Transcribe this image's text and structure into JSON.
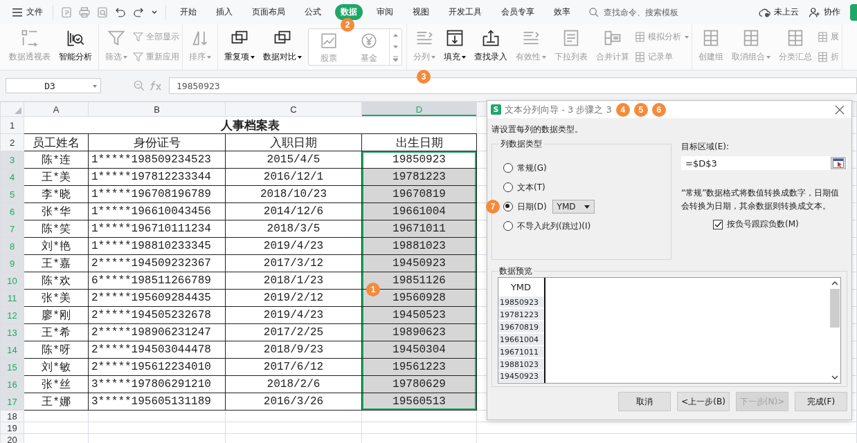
{
  "menu_bar": {
    "file": "文件",
    "tabs": [
      {
        "label": "开始",
        "selected": false
      },
      {
        "label": "插入",
        "selected": false
      },
      {
        "label": "页面布局",
        "selected": false
      },
      {
        "label": "公式",
        "selected": false
      },
      {
        "label": "数据",
        "selected": true,
        "marker": "2"
      },
      {
        "label": "审阅",
        "selected": false
      },
      {
        "label": "视图",
        "selected": false
      },
      {
        "label": "开发工具",
        "selected": false
      },
      {
        "label": "会员专享",
        "selected": false
      },
      {
        "label": "效率",
        "selected": false
      }
    ],
    "search": {
      "placeholder": "查找命令、搜索模板"
    },
    "cloud_status": "未上云",
    "collaborate": "协作"
  },
  "ribbon": {
    "groups": [
      {
        "items": [
          {
            "kind": "large",
            "label": "数据透视表",
            "disabled": true,
            "dropdown": false
          },
          {
            "kind": "large",
            "label": "智能分析",
            "disabled": false,
            "dropdown": false
          }
        ]
      },
      {
        "items": [
          {
            "kind": "large",
            "label": "筛选",
            "disabled": true,
            "dropdown": true
          },
          {
            "kind": "stack",
            "items": [
              {
                "label": "全部显示",
                "disabled": true,
                "dropdown": false
              },
              {
                "label": "重新应用",
                "disabled": true,
                "dropdown": false
              }
            ]
          }
        ]
      },
      {
        "items": [
          {
            "kind": "large",
            "label": "排序",
            "disabled": true,
            "dropdown": true
          }
        ]
      },
      {
        "items": [
          {
            "kind": "large",
            "label": "重复项",
            "disabled": false,
            "dropdown": true
          },
          {
            "kind": "large",
            "label": "数据对比",
            "disabled": false,
            "dropdown": true
          },
          {
            "kind": "gallery",
            "items": [
              {
                "label": "股票",
                "disabled": true
              },
              {
                "label": "基金",
                "disabled": true
              }
            ]
          }
        ]
      },
      {
        "items": [
          {
            "kind": "large",
            "label": "分列",
            "disabled": true,
            "dropdown": true,
            "marker": "3"
          },
          {
            "kind": "large",
            "label": "填充",
            "disabled": false,
            "dropdown": true
          },
          {
            "kind": "large",
            "label": "查找录入",
            "disabled": false,
            "dropdown": false
          },
          {
            "kind": "large",
            "label": "有效性",
            "disabled": true,
            "dropdown": true
          },
          {
            "kind": "large",
            "label": "下拉列表",
            "disabled": true,
            "dropdown": false
          },
          {
            "kind": "large",
            "label": "合并计算",
            "disabled": true,
            "dropdown": false
          },
          {
            "kind": "stack",
            "items": [
              {
                "label": "模拟分析",
                "disabled": true,
                "dropdown": true
              },
              {
                "label": "记录单",
                "disabled": true,
                "dropdown": false
              }
            ]
          }
        ]
      },
      {
        "items": [
          {
            "kind": "large",
            "label": "创建组",
            "disabled": true,
            "dropdown": false
          },
          {
            "kind": "large",
            "label": "取消组合",
            "disabled": true,
            "dropdown": true
          },
          {
            "kind": "large",
            "label": "分类汇总",
            "disabled": true,
            "dropdown": false
          },
          {
            "kind": "stack",
            "items": [
              {
                "label": "展",
                "disabled": true,
                "dropdown": false
              },
              {
                "label": "折",
                "disabled": true,
                "dropdown": false
              }
            ]
          }
        ]
      }
    ]
  },
  "formula_bar": {
    "name_box": "D3",
    "formula": "19850923"
  },
  "sheet": {
    "columns": [
      {
        "label": "A",
        "selected": false
      },
      {
        "label": "B",
        "selected": false
      },
      {
        "label": "C",
        "selected": false
      },
      {
        "label": "D",
        "selected": true
      }
    ],
    "title_row": "1",
    "title": "人事档案表",
    "header_row": "2",
    "headers": [
      "员工姓名",
      "身份证号",
      "入职日期",
      "出生日期"
    ],
    "rows": [
      {
        "number": "3",
        "name": "陈*连",
        "id": "1*****198509234523",
        "hire_date": "2015/4/5",
        "birth_date": "19850923",
        "selected": true,
        "active": true
      },
      {
        "number": "4",
        "name": "王*美",
        "id": "1*****197812233344",
        "hire_date": "2016/12/1",
        "birth_date": "19781223",
        "selected": true,
        "active": false
      },
      {
        "number": "5",
        "name": "李*晓",
        "id": "1*****196708196789",
        "hire_date": "2018/10/23",
        "birth_date": "19670819",
        "selected": true,
        "active": false
      },
      {
        "number": "6",
        "name": "张*华",
        "id": "1*****196610043456",
        "hire_date": "2014/12/6",
        "birth_date": "19661004",
        "selected": true,
        "active": false
      },
      {
        "number": "7",
        "name": "陈*笑",
        "id": "1*****196710111234",
        "hire_date": "2018/3/5",
        "birth_date": "19671011",
        "selected": true,
        "active": false
      },
      {
        "number": "8",
        "name": "刘*艳",
        "id": "1*****198810233345",
        "hire_date": "2019/4/23",
        "birth_date": "19881023",
        "selected": true,
        "active": false
      },
      {
        "number": "9",
        "name": "王*嘉",
        "id": "2*****194509232367",
        "hire_date": "2017/3/12",
        "birth_date": "19450923",
        "selected": true,
        "active": false
      },
      {
        "number": "10",
        "name": "陈*欢",
        "id": "6*****198511266789",
        "hire_date": "2018/1/23",
        "birth_date": "19851126",
        "selected": true,
        "active": false,
        "marker": "1"
      },
      {
        "number": "11",
        "name": "张*美",
        "id": "2*****195609284435",
        "hire_date": "2019/2/12",
        "birth_date": "19560928",
        "selected": true,
        "active": false
      },
      {
        "number": "12",
        "name": "廖*刚",
        "id": "2*****194505232678",
        "hire_date": "2019/4/23",
        "birth_date": "19450523",
        "selected": true,
        "active": false
      },
      {
        "number": "13",
        "name": "王*希",
        "id": "2*****198906231247",
        "hire_date": "2017/2/25",
        "birth_date": "19890623",
        "selected": true,
        "active": false
      },
      {
        "number": "14",
        "name": "陈*呀",
        "id": "2*****194503044478",
        "hire_date": "2018/9/23",
        "birth_date": "19450304",
        "selected": true,
        "active": false
      },
      {
        "number": "15",
        "name": "刘*敏",
        "id": "2*****195612234010",
        "hire_date": "2017/6/12",
        "birth_date": "19561223",
        "selected": true,
        "active": false
      },
      {
        "number": "16",
        "name": "张*丝",
        "id": "3*****197806291210",
        "hire_date": "2018/2/6",
        "birth_date": "19780629",
        "selected": true,
        "active": false
      },
      {
        "number": "17",
        "name": "王*娜",
        "id": "3*****195605131189",
        "hire_date": "2016/3/26",
        "birth_date": "19560513",
        "selected": true,
        "active": false
      }
    ],
    "empty_rows": [
      "18",
      "19",
      "20"
    ]
  },
  "dialog": {
    "icon_text": "S",
    "title": "文本分列向导 - 3 步骤之 3",
    "markers": [
      "4",
      "5",
      "6"
    ],
    "instruction": "请设置每列的数据类型。",
    "column_type": {
      "legend": "列数据类型",
      "options": [
        {
          "label": "常规(G)",
          "selected": false
        },
        {
          "label": "文本(T)",
          "selected": false
        },
        {
          "label": "日期(D)",
          "selected": true,
          "dropdown": "YMD",
          "marker": "7"
        },
        {
          "label": "不导入此列(跳过)(I)",
          "selected": false
        }
      ]
    },
    "destination": {
      "label": "目标区域(E):",
      "value": "=$D$3"
    },
    "description": "“常规”数据格式将数值转换成数字，日期值会转换为日期，其余数据则转换成文本。",
    "checkbox": {
      "label": "按负号跟踪负数(M)",
      "checked": true
    },
    "preview": {
      "legend": "数据预览",
      "header": "YMD",
      "values": [
        "19850923",
        "19781223",
        "19670819",
        "19661004",
        "19671011",
        "19881023",
        "19450923"
      ]
    },
    "buttons": [
      {
        "label": "取消",
        "disabled": false
      },
      {
        "label": "<上一步(B)",
        "disabled": false
      },
      {
        "label": "下一步(N)>",
        "disabled": true
      },
      {
        "label": "完成(F)",
        "disabled": false
      }
    ]
  }
}
